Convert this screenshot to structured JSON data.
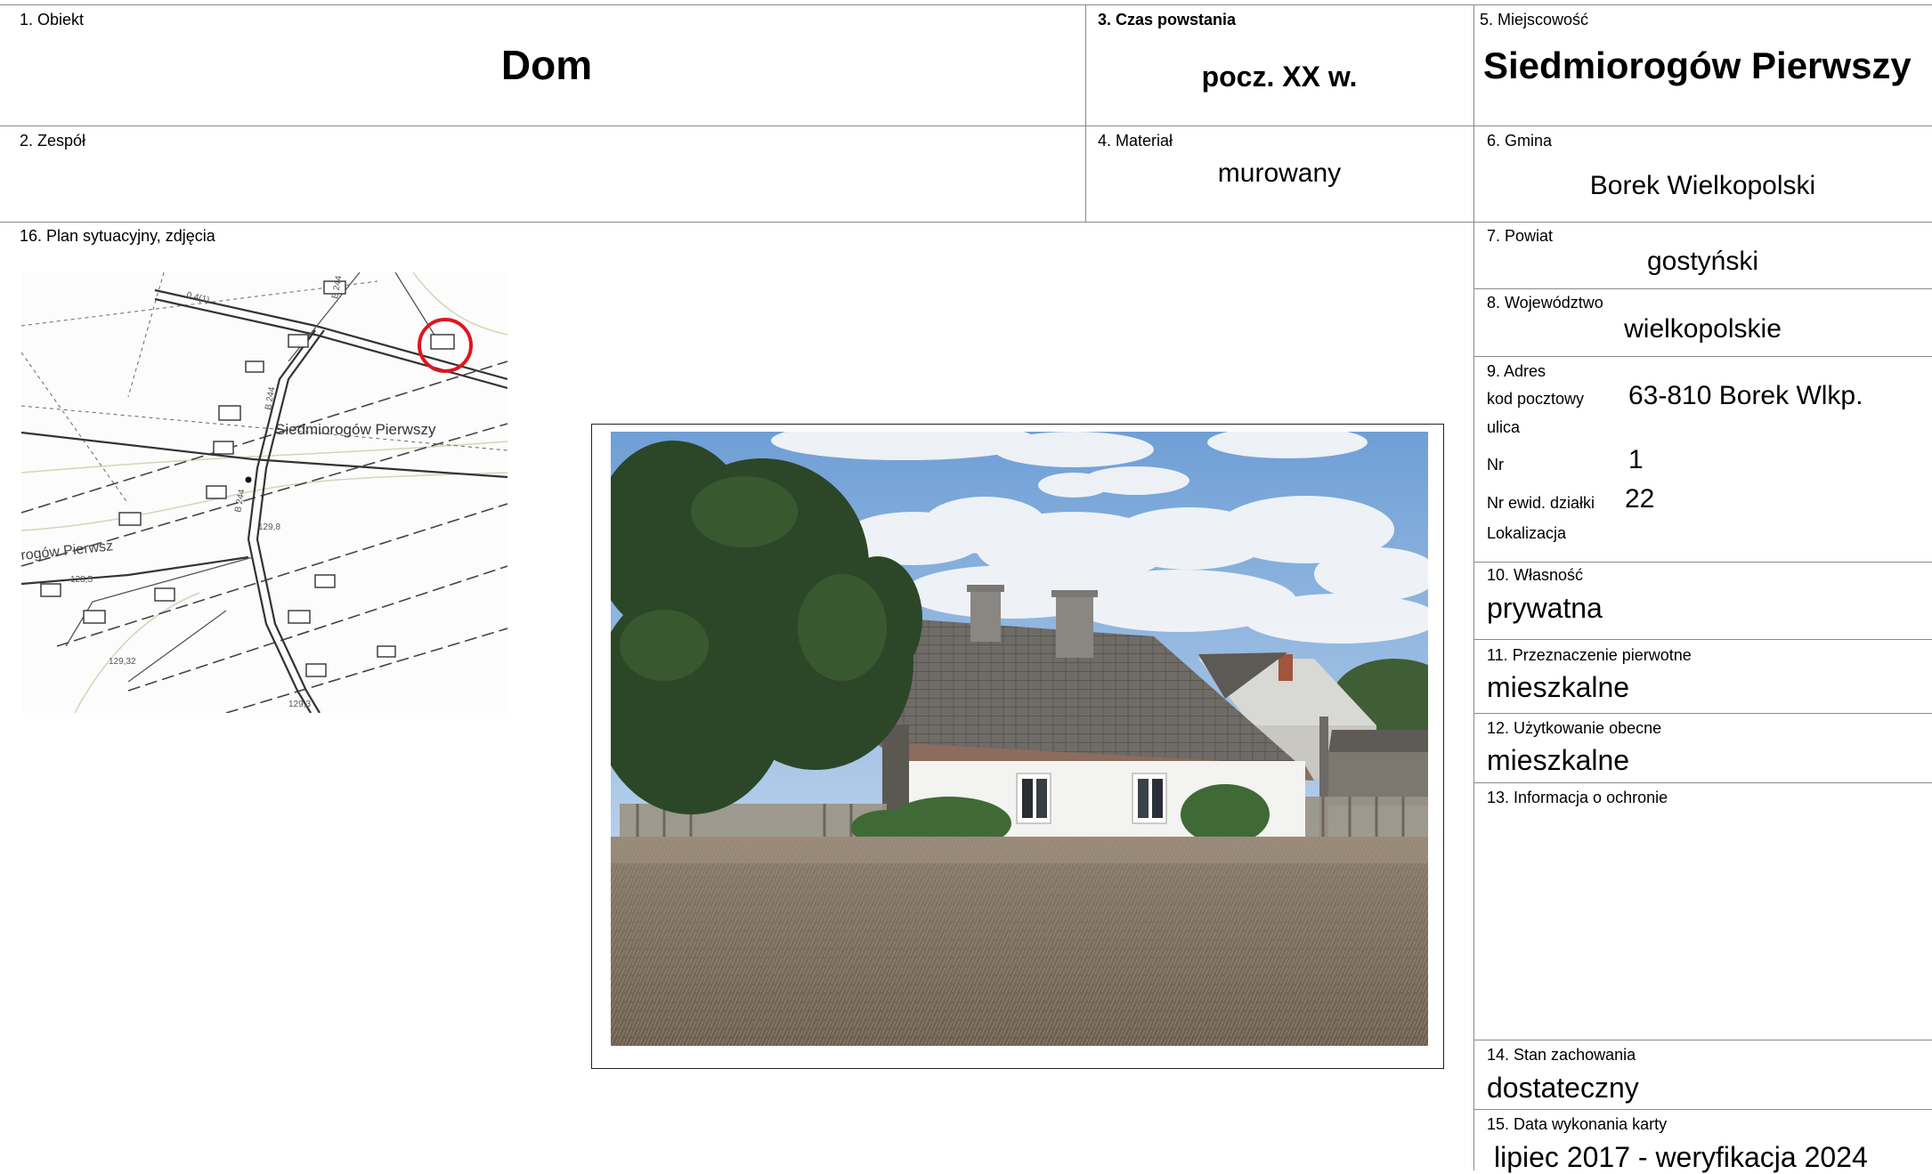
{
  "fields": {
    "obiekt": {
      "label": "1. Obiekt",
      "value": "Dom"
    },
    "zespol": {
      "label": "2. Zespół",
      "value": ""
    },
    "czas": {
      "label": "3. Czas powstania",
      "value": "pocz. XX w."
    },
    "material": {
      "label": "4. Materiał",
      "value": "murowany"
    },
    "miejscowosc": {
      "label": "5. Miejscowość",
      "value": "Siedmiorogów Pierwszy"
    },
    "gmina": {
      "label": "6. Gmina",
      "value": "Borek Wielkopolski"
    },
    "powiat": {
      "label": "7. Powiat",
      "value": "gostyński"
    },
    "wojewodztwo": {
      "label": "8. Województwo",
      "value": "wielkopolskie"
    },
    "adres": {
      "label": "9. Adres",
      "kod_label": "kod pocztowy",
      "kod_value": "63-810 Borek Wlkp.",
      "ulica_label": "ulica",
      "nr_label": "Nr",
      "nr_value": "1",
      "dzialka_label": "Nr ewid. działki",
      "dzialka_value": "22",
      "lokalizacja_label": "Lokalizacja"
    },
    "wlasnosc": {
      "label": "10. Własność",
      "value": "prywatna"
    },
    "przeznaczenie": {
      "label": "11. Przeznaczenie pierwotne",
      "value": "mieszkalne"
    },
    "uzytkowanie": {
      "label": "12. Użytkowanie obecne",
      "value": "mieszkalne"
    },
    "ochrona": {
      "label": "13. Informacja o ochronie",
      "value": ""
    },
    "stan": {
      "label": "14. Stan zachowania",
      "value": "dostateczny"
    },
    "data": {
      "label": "15. Data wykonania karty",
      "value": "lipiec 2017 - weryfikacja 2024"
    },
    "plan": {
      "label": "16. Plan sytuacyjny, zdjęcia"
    }
  },
  "map": {
    "place_label": "Siedmiorogów Pierwszy",
    "place_label_partial": "rogów Pierwsz",
    "road_labels": [
      "0 4(1)",
      "B 244",
      "B 244",
      "B 244"
    ],
    "elevations": [
      "129,8",
      "128,5",
      "129,32",
      "129,3"
    ],
    "marker_color": "#e0141e"
  },
  "photo": {
    "sky_color": "#8cb4e0",
    "field_color": "#8a7a68",
    "tree_color": "#2f4a2a",
    "roof_color": "#6e6a64",
    "wall_color": "#f2f2f0"
  }
}
